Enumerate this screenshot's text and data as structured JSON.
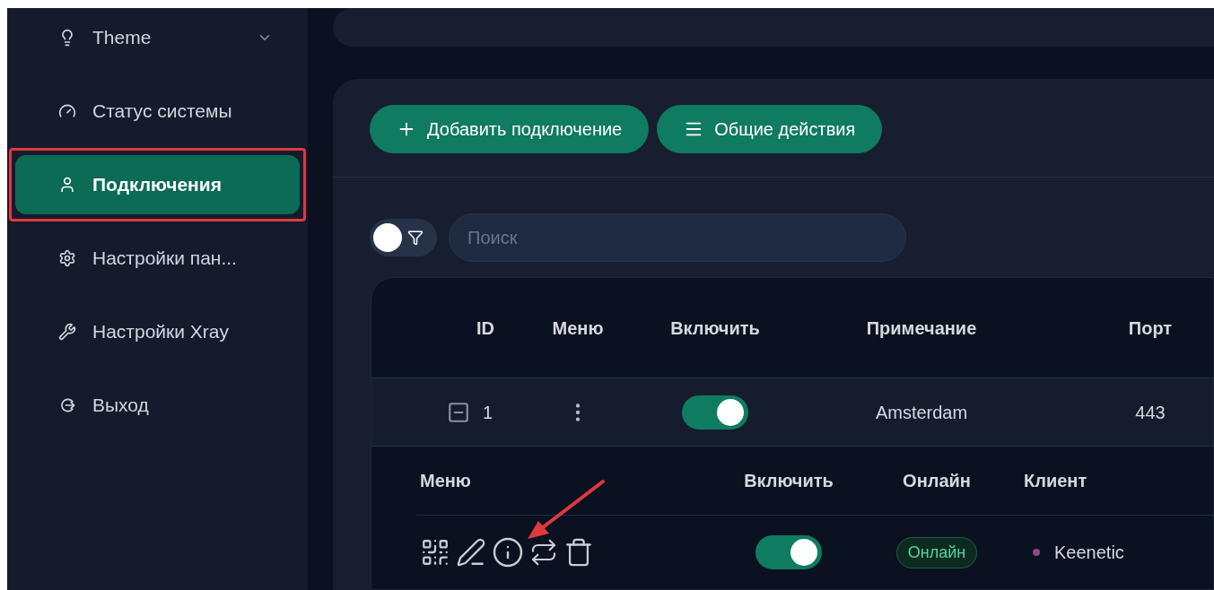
{
  "sidebar": {
    "items": [
      {
        "label": "Theme",
        "kind": "submenu",
        "selected": false,
        "highlighted": false
      },
      {
        "label": "Статус системы",
        "kind": "link",
        "selected": false,
        "highlighted": false
      },
      {
        "label": "Подключения",
        "kind": "link",
        "selected": true,
        "highlighted": true
      },
      {
        "label": "Настройки пан...",
        "kind": "link",
        "selected": false,
        "highlighted": false
      },
      {
        "label": "Настройки Xray",
        "kind": "link",
        "selected": false,
        "highlighted": false
      },
      {
        "label": "Выход",
        "kind": "link",
        "selected": false,
        "highlighted": false
      }
    ]
  },
  "toolbar": {
    "buttons": [
      {
        "label": "Добавить подключение"
      },
      {
        "label": "Общие действия"
      }
    ]
  },
  "filter_toggle": {
    "on": false
  },
  "search": {
    "placeholder": "Поиск"
  },
  "table": {
    "columns": [
      "ID",
      "Меню",
      "Включить",
      "Примечание",
      "Порт"
    ],
    "rows": [
      {
        "id": "1",
        "expanded": true,
        "enabled": true,
        "remark": "Amsterdam",
        "port": "443"
      }
    ]
  },
  "clients": {
    "columns": [
      "Меню",
      "Включить",
      "Онлайн",
      "Клиент"
    ],
    "rows": [
      {
        "enabled": true,
        "online": true,
        "status": "Онлайн",
        "name": "Keenetic",
        "color": "#8e4a86"
      }
    ]
  }
}
